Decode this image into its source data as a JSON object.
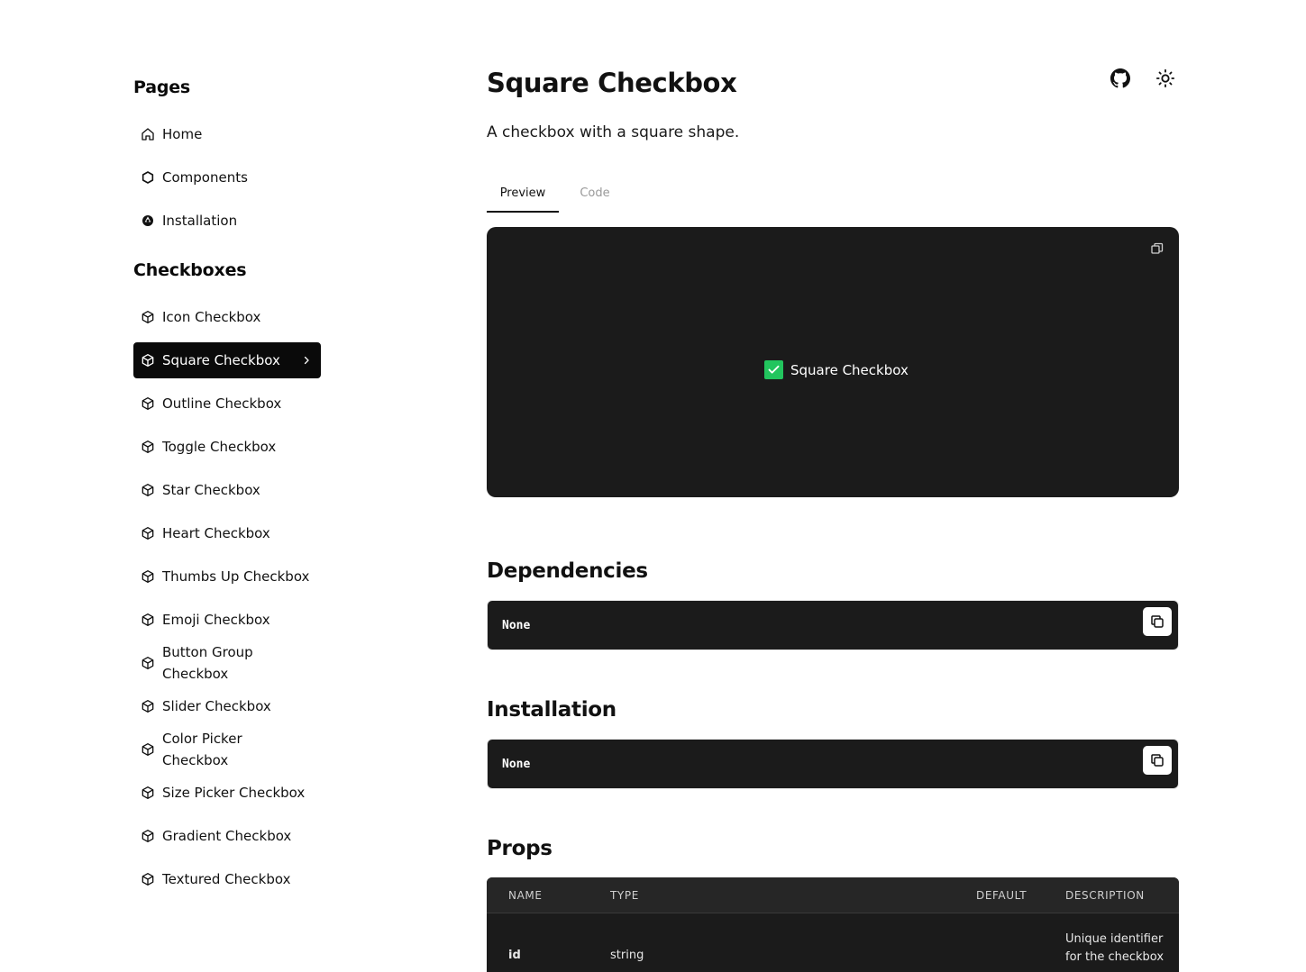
{
  "sidebar": {
    "pages_title": "Pages",
    "pages": [
      {
        "label": "Home",
        "icon": "home-icon"
      },
      {
        "label": "Components",
        "icon": "hexagon-icon"
      },
      {
        "label": "Installation",
        "icon": "aperture-icon"
      }
    ],
    "checkboxes_title": "Checkboxes",
    "checkboxes": [
      {
        "label": "Icon Checkbox"
      },
      {
        "label": "Square Checkbox",
        "active": true
      },
      {
        "label": "Outline Checkbox"
      },
      {
        "label": "Toggle Checkbox"
      },
      {
        "label": "Star Checkbox"
      },
      {
        "label": "Heart Checkbox"
      },
      {
        "label": "Thumbs Up Checkbox"
      },
      {
        "label": "Emoji Checkbox"
      },
      {
        "label": "Button Group Checkbox"
      },
      {
        "label": "Slider Checkbox"
      },
      {
        "label": "Color Picker Checkbox"
      },
      {
        "label": "Size Picker Checkbox"
      },
      {
        "label": "Gradient Checkbox"
      },
      {
        "label": "Textured Checkbox"
      }
    ]
  },
  "header": {
    "title": "Square Checkbox",
    "description": "A checkbox with a square shape."
  },
  "tabs": [
    {
      "label": "Preview",
      "active": true
    },
    {
      "label": "Code",
      "active": false
    }
  ],
  "preview": {
    "checkbox_label": "Square Checkbox",
    "checked": true,
    "accent_color": "#22c55e"
  },
  "dependencies": {
    "title": "Dependencies",
    "code": "None"
  },
  "installation": {
    "title": "Installation",
    "code": "None"
  },
  "props": {
    "title": "Props",
    "columns": [
      "NAME",
      "TYPE",
      "DEFAULT",
      "DESCRIPTION"
    ],
    "rows": [
      {
        "name": "id",
        "type": "string",
        "default": "",
        "description": "Unique identifier for the checkbox"
      }
    ]
  }
}
